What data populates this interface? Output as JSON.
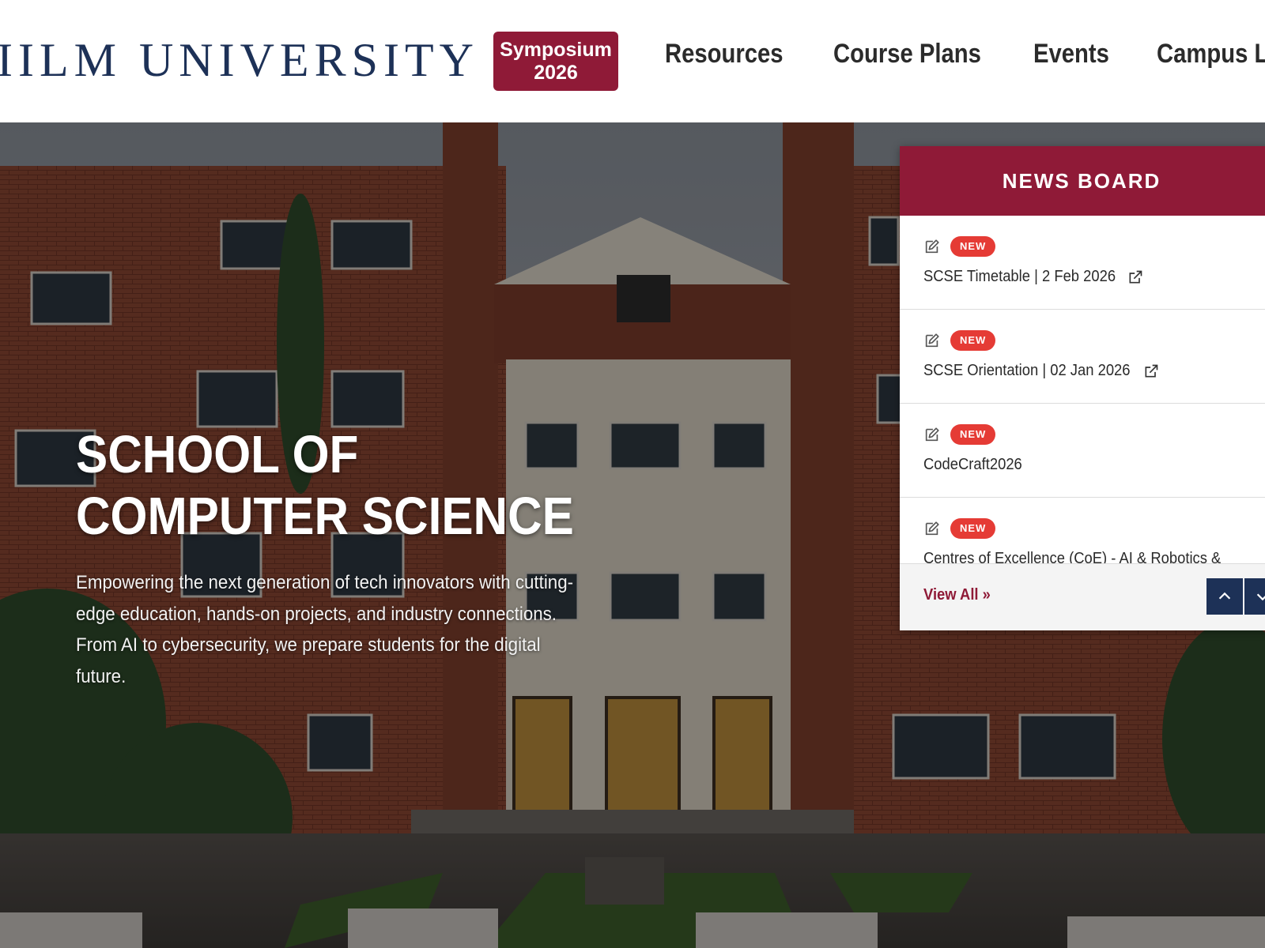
{
  "header": {
    "logo_text": "IILM UNIVERSITY",
    "symposium_line1": "Symposium",
    "symposium_line2": "2026",
    "nav": [
      "Resources",
      "Course Plans",
      "Events",
      "Campus L"
    ]
  },
  "hero": {
    "title_line1": "SCHOOL OF",
    "title_line2": "COMPUTER SCIENCE",
    "description": "Empowering the next generation of tech innovators with cutting-edge education, hands-on projects, and industry connections. From AI to cybersecurity, we prepare students for the digital future."
  },
  "news_board": {
    "title": "NEWS BOARD",
    "badge_label": "NEW",
    "items": [
      {
        "text": "SCSE Timetable | 2 Feb 2026"
      },
      {
        "text": "SCSE Orientation | 02 Jan 2026"
      },
      {
        "text": "CodeCraft2026"
      },
      {
        "text": "Centres of Excellence (CoE) - AI & Robotics &"
      }
    ],
    "view_all": "View All »"
  },
  "colors": {
    "brand_maroon": "#8f1a37",
    "brand_navy": "#1d3157",
    "badge_red": "#e53b35"
  }
}
